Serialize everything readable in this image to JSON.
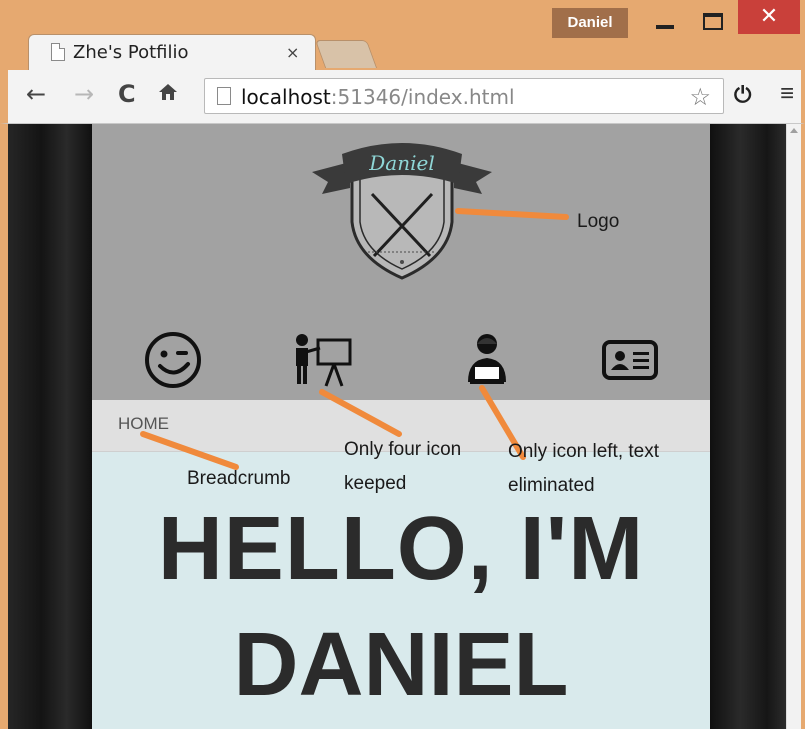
{
  "browser": {
    "tab_title": "Zhe's Potfilio",
    "tab_close": "×",
    "profile_name": "Daniel",
    "url_host": "localhost",
    "url_rest": ":51346/index.html",
    "window_close": "✕"
  },
  "page": {
    "logo_text": "Daniel",
    "nav_icons": [
      "smiley-icon",
      "presenter-icon",
      "person-laptop-icon",
      "contact-card-icon"
    ],
    "breadcrumb": "HOME",
    "hero_line1": "HELLO, I'M",
    "hero_line2": "DANIEL"
  },
  "annotations": {
    "logo": "Logo",
    "breadcrumb": "Breadcrumb",
    "four_icon_line1": "Only four icon",
    "four_icon_line2": "keeped",
    "icon_only_line1": "Only icon left, text",
    "icon_only_line2": "eliminated",
    "arrow_color": "#f08a3c"
  },
  "colors": {
    "title_bar": "#e6a970",
    "header_bg": "#a2a2a2",
    "breadcrumb_bg": "#e0e0e0",
    "hero_bg": "#d9eaec",
    "logo_ribbon": "#3a3a3a",
    "logo_text": "#8fd6d6"
  }
}
